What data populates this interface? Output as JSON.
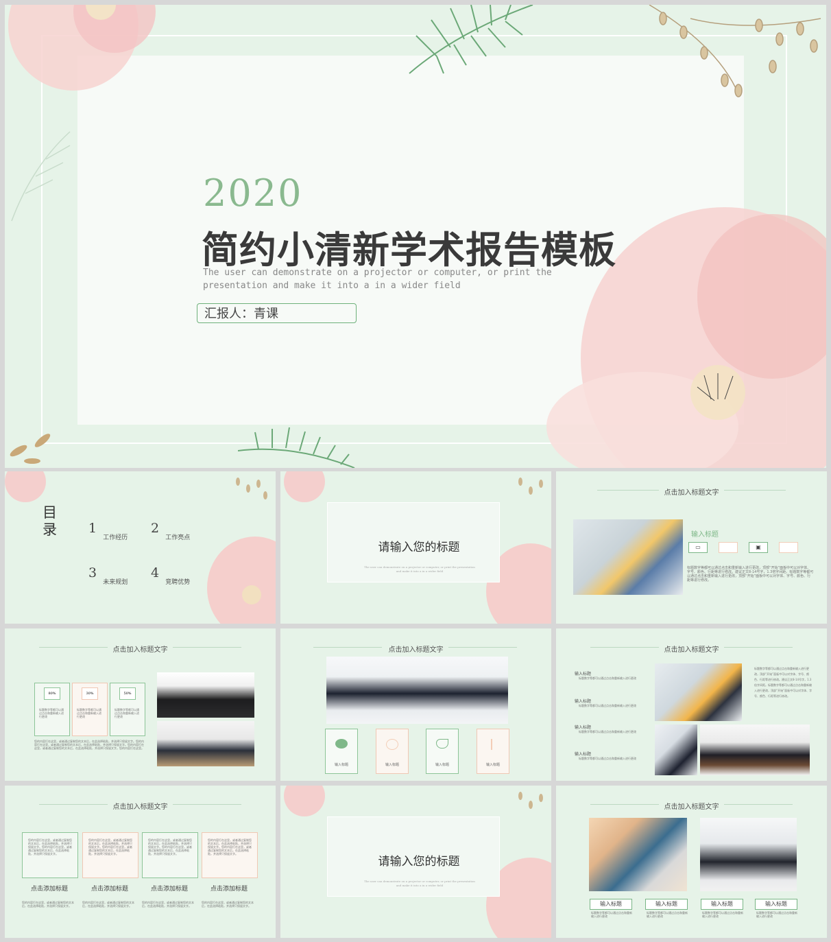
{
  "colors": {
    "accent_green": "#6db07a",
    "bg_green": "#e6f3e8",
    "pink": "#f4c3c3"
  },
  "slide_main": {
    "year": "2020",
    "title": "简约小清新学术报告模板",
    "subtitle": "The user can demonstrate on a projector or computer, or print the presentation and make it into a in a wider field",
    "reporter": "汇报人：青课"
  },
  "slide_toc": {
    "heading": "目录",
    "items": [
      {
        "num": "1",
        "label": "工作经历"
      },
      {
        "num": "2",
        "label": "工作亮点"
      },
      {
        "num": "3",
        "label": "未来规划"
      },
      {
        "num": "4",
        "label": "竞聘优势"
      }
    ]
  },
  "slide_section": {
    "title": "请输入您的标题",
    "desc": "The user can demonstrate on a projector or computer, or print the presentation and make it into a in a wider field"
  },
  "slide_text_img": {
    "section_title": "点击加入标题文字",
    "heading": "输入标题",
    "body": "标题数字等都可以通过点击和重新输入进行更改，顶部“开始”面板中可以对字体、字号、颜色、行距等进行修改。建议正文8-14号字，1.3倍字间距。标题数字等都可以通过点击和重新输入进行更改，顶部“开始”面板中可以对字体、字号、颜色、行距等进行修改。"
  },
  "slide_percent": {
    "section_title": "点击加入标题文字",
    "cards": [
      {
        "pct": "80%",
        "text": "标题数字等都可以通过点击和重新输入进行更改"
      },
      {
        "pct": "30%",
        "text": "标题数字等都可以通过点击和重新输入进行更改"
      },
      {
        "pct": "50%",
        "text": "标题数字等都可以通过点击和重新输入进行更改"
      }
    ],
    "body": "您的内容打在这里，或者通过复制您的文本后，在此选择粘贴，并选择只保留文字。您的内容打在这里，或者通过复制您的文本后，在此选择粘贴，并选择只保留文字。您的内容打在这里，或者通过复制您的文本后，在此选择粘贴，并选择只保留文字。您的内容打在这里。"
  },
  "slide_icons": {
    "section_title": "点击加入标题文字",
    "icons": [
      {
        "label": "输入标题",
        "icon": "weibo-icon"
      },
      {
        "label": "输入标题",
        "icon": "image-icon"
      },
      {
        "label": "输入标题",
        "icon": "twitter-icon"
      },
      {
        "label": "输入标题",
        "icon": "cursor-icon"
      }
    ]
  },
  "slide_list": {
    "section_title": "点击加入标题文字",
    "items": [
      {
        "title": "输入标题",
        "text": "标题数字等都可以通过点击和重新输入进行更改"
      },
      {
        "title": "输入标题",
        "text": "标题数字等都可以通过点击和重新输入进行更改"
      },
      {
        "title": "输入标题",
        "text": "标题数字等都可以通过点击和重新输入进行更改"
      },
      {
        "title": "输入标题",
        "text": "标题数字等都可以通过点击和重新输入进行更改"
      }
    ],
    "right_text": "标题数字等都可以通过点击和重新输入进行更改，顶部“开始”面板中可以对字体、字号、颜色、行距等进行修改。建议正文8-14号字，1.3倍字间距。标题数字等都可以通过点击和重新输入进行更改，顶部“开始”面板中可以对字体、字号、颜色、行距等进行修改。"
  },
  "slide_four": {
    "section_title": "点击加入标题文字",
    "boxes": [
      "您的内容打在这里，或者通过复制您的文本后，在此选择粘贴，并选择只保留文字。您的内容打在这里，或者通过复制您的文本后，在此选择粘贴，并选择只保留文字。",
      "您的内容打在这里，或者通过复制您的文本后，在此选择粘贴，并选择只保留文字。您的内容打在这里，或者通过复制您的文本后，在此选择粘贴，并选择只保留文字。",
      "您的内容打在这里，或者通过复制您的文本后，在此选择粘贴，并选择只保留文字。您的内容打在这里，或者通过复制您的文本后，在此选择粘贴，并选择只保留文字。",
      "您的内容打在这里，或者通过复制您的文本后，在此选择粘贴，并选择只保留文字。您的内容打在这里，或者通过复制您的文本后，在此选择粘贴，并选择只保留文字。"
    ],
    "titles": [
      "点击添加标题",
      "点击添加标题",
      "点击添加标题",
      "点击添加标题"
    ],
    "texts": [
      "您的内容打在这里，或者通过复制您的文本后，在此选择粘贴，并选择只保留文字。",
      "您的内容打在这里，或者通过复制您的文本后，在此选择粘贴，并选择只保留文字。",
      "您的内容打在这里，或者通过复制您的文本后，在此选择粘贴，并选择只保留文字。",
      "您的内容打在这里，或者通过复制您的文本后，在此选择粘贴，并选择只保留文字。"
    ]
  },
  "slide_section2": {
    "title": "请输入您的标题",
    "desc": "The user can demonstrate on a projector or computer, or print the presentation and make it into a in a wider field"
  },
  "slide_photos": {
    "section_title": "点击加入标题文字",
    "buttons": [
      "输入标题",
      "输入标题",
      "输入标题",
      "输入标题"
    ],
    "texts": [
      "标题数字等都可以通过点击和重新输入进行更改",
      "标题数字等都可以通过点击和重新输入进行更改",
      "标题数字等都可以通过点击和重新输入进行更改",
      "标题数字等都可以通过点击和重新输入进行更改"
    ]
  }
}
